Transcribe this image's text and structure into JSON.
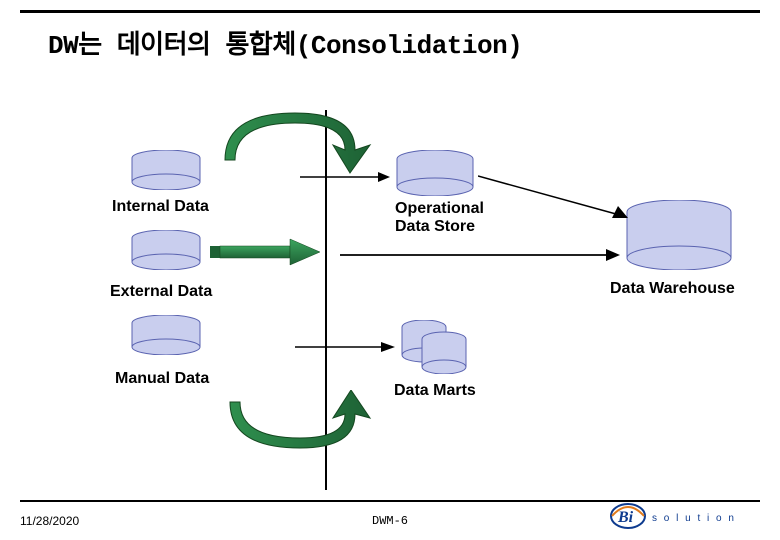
{
  "title": "DW는 데이터의 통합체(Consolidation)",
  "labels": {
    "internal": "Internal Data",
    "external": "External Data",
    "manual": "Manual Data",
    "ods": "Operational\nData Store",
    "marts": "Data Marts",
    "dw": "Data Warehouse"
  },
  "footer": {
    "date": "11/28/2020",
    "page": "DWM-6",
    "logo_text": "solution",
    "logo_mark": "Bi"
  },
  "colors": {
    "cyl_fill": "#C9CEEE",
    "cyl_stroke": "#7A82C0",
    "arrow_green": "#2F8F4E",
    "arrow_green_dark": "#1E6235",
    "logo_blue": "#0E3B8F",
    "logo_orange": "#E07A1C"
  }
}
